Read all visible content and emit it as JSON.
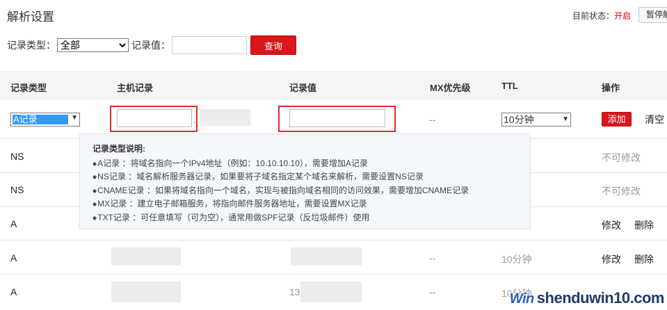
{
  "page": {
    "title": "解析设置"
  },
  "status": {
    "label": "目前状态：",
    "value": "开启",
    "pause_button": "暂停解"
  },
  "filter": {
    "type_label": "记录类型：",
    "type_value": "全部",
    "value_label": "记录值：",
    "value_input": "",
    "query_button": "查询"
  },
  "table": {
    "headers": [
      "记录类型",
      "主机记录",
      "记录值",
      "MX优先级",
      "TTL",
      "操作"
    ],
    "new_row": {
      "type_selected": "A记录",
      "host_input": "",
      "host_suffix": ".",
      "value_input": "",
      "mx": "--",
      "ttl_selected": "10分钟",
      "add_button": "添加",
      "clear_link": "清空"
    },
    "rows": [
      {
        "type": "NS",
        "mx": "",
        "ttl": "",
        "action1": "不可修改",
        "action2": "",
        "value": ""
      },
      {
        "type": "NS",
        "mx": "",
        "ttl": "",
        "action1": "不可修改",
        "action2": "",
        "value": ""
      },
      {
        "type": "A",
        "mx": "",
        "ttl": "",
        "action1": "修改",
        "action2": "删除",
        "value": ""
      },
      {
        "type": "A",
        "mx": "--",
        "ttl": "10分钟",
        "action1": "修改",
        "action2": "删除",
        "value": ""
      },
      {
        "type": "A",
        "mx": "--",
        "ttl": "10分钟",
        "action1": "",
        "action2": "",
        "value": "13"
      }
    ]
  },
  "tooltip": {
    "title": "记录类型说明:",
    "items": [
      "A记录 ：将域名指向一个IPv4地址（例如：10.10.10.10），需要增加A记录",
      "NS记录 ：域名解析服务器记录，如果要将子域名指定某个域名来解析，需要设置NS记录",
      "CNAME记录 ：如果将域名指向一个域名，实现与被指向域名相同的访问效果，需要增加CNAME记录",
      "MX记录 ：建立电子邮箱服务，将指向邮件服务器地址，需要设置MX记录",
      "TXT记录 ：可任意填写（可为空），通常用做SPF记录（反垃圾邮件）使用"
    ]
  },
  "watermark": {
    "logo": "Win",
    "text": "shenduwin10.com"
  }
}
